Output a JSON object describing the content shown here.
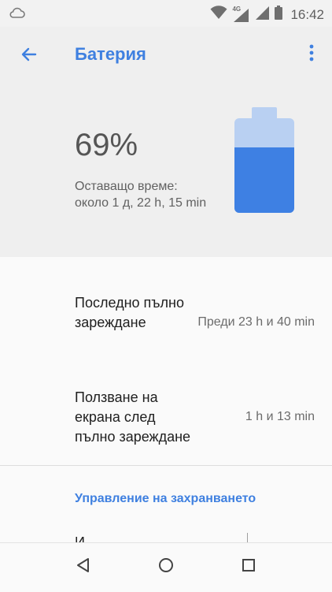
{
  "status_bar": {
    "time": "16:42",
    "network_label": "4G",
    "icons": [
      "cloud-icon",
      "wifi-icon",
      "cell-signal-icon",
      "cell-signal-icon",
      "battery-icon"
    ]
  },
  "app_bar": {
    "title": "Батерия",
    "back_icon": "arrow-back-icon",
    "more_icon": "more-vert-icon"
  },
  "battery": {
    "percent_text": "69%",
    "level": 0.69,
    "remaining_label": "Оставащо време:",
    "remaining_value": "около 1 д, 22 h, 15 min",
    "colors": {
      "fill": "#3e80e3",
      "empty": "#b9d0f2"
    }
  },
  "list": {
    "items": [
      {
        "title": "Последно пълно зареждане",
        "value": "Преди 23 h и 40 min"
      },
      {
        "title": "Ползване на екрана след пълно зареждане",
        "value": "1 h и 13 min"
      }
    ]
  },
  "section": {
    "title": "Управление на захранването"
  },
  "partial_row": {
    "text": "И"
  },
  "nav_bar": {
    "icons": [
      "nav-back-icon",
      "nav-home-icon",
      "nav-recents-icon"
    ]
  },
  "theme": {
    "accent": "#3f80e0",
    "header_bg": "#efefef",
    "page_bg": "#fafafa"
  }
}
